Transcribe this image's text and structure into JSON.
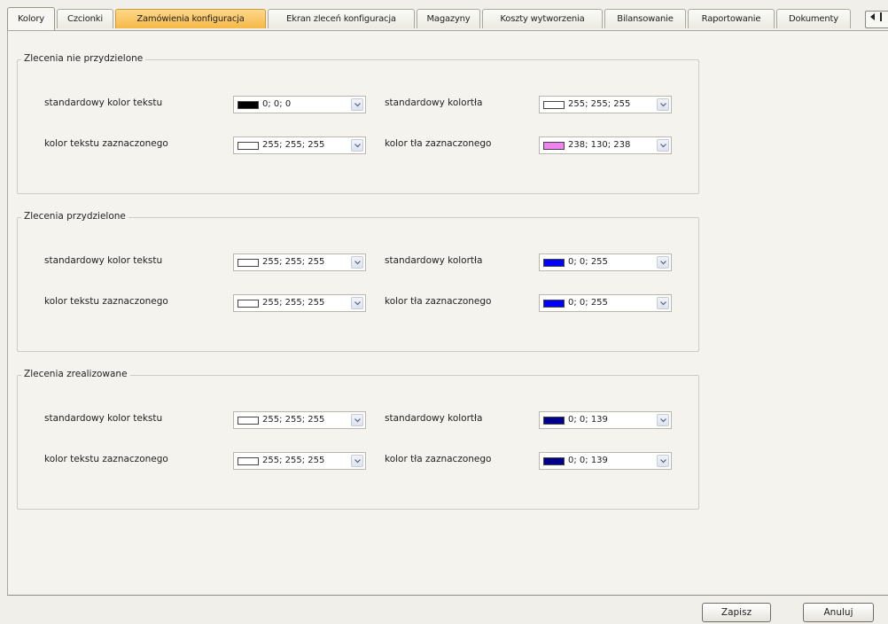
{
  "tabs": [
    {
      "label": "Kolory"
    },
    {
      "label": "Czcionki"
    },
    {
      "label": "Zamówienia konfiguracja"
    },
    {
      "label": "Ekran zleceń konfiguracja"
    },
    {
      "label": "Magazyny"
    },
    {
      "label": "Koszty wytworzenia"
    },
    {
      "label": "Bilansowanie"
    },
    {
      "label": "Raportowanie"
    },
    {
      "label": "Dokumenty"
    }
  ],
  "active_tab": "Kolory",
  "highlighted_tab": "Zamówienia konfiguracja",
  "groups": [
    {
      "title": "Zlecenia nie przydzielone",
      "fields": [
        {
          "label": "standardowy kolor tekstu",
          "value": "0; 0; 0",
          "color": "#000000"
        },
        {
          "label": "standardowy kolortła",
          "value": "255; 255; 255",
          "color": "#ffffff"
        },
        {
          "label": "kolor tekstu zaznaczonego",
          "value": "255; 255; 255",
          "color": "#ffffff"
        },
        {
          "label": "kolor tła zaznaczonego",
          "value": "238; 130; 238",
          "color": "#ee82ee"
        }
      ]
    },
    {
      "title": "Zlecenia przydzielone",
      "fields": [
        {
          "label": "standardowy kolor tekstu",
          "value": "255; 255; 255",
          "color": "#ffffff"
        },
        {
          "label": "standardowy kolortła",
          "value": "0; 0; 255",
          "color": "#0000ff"
        },
        {
          "label": "kolor tekstu zaznaczonego",
          "value": "255; 255; 255",
          "color": "#ffffff"
        },
        {
          "label": "kolor tła zaznaczonego",
          "value": "0; 0; 255",
          "color": "#0000ff"
        }
      ]
    },
    {
      "title": "Zlecenia zrealizowane",
      "fields": [
        {
          "label": "standardowy kolor tekstu",
          "value": "255; 255; 255",
          "color": "#ffffff"
        },
        {
          "label": "standardowy kolortła",
          "value": "0; 0; 139",
          "color": "#00008b"
        },
        {
          "label": "kolor tekstu zaznaczonego",
          "value": "255; 255; 255",
          "color": "#ffffff"
        },
        {
          "label": "kolor tła zaznaczonego",
          "value": "0; 0; 139",
          "color": "#00008b"
        }
      ]
    }
  ],
  "buttons": {
    "save": "Zapisz",
    "cancel": "Anuluj"
  },
  "icons": {
    "tab_scroll": "tab-scroll-arrows-icon",
    "dropdown": "chevron-down-icon"
  }
}
